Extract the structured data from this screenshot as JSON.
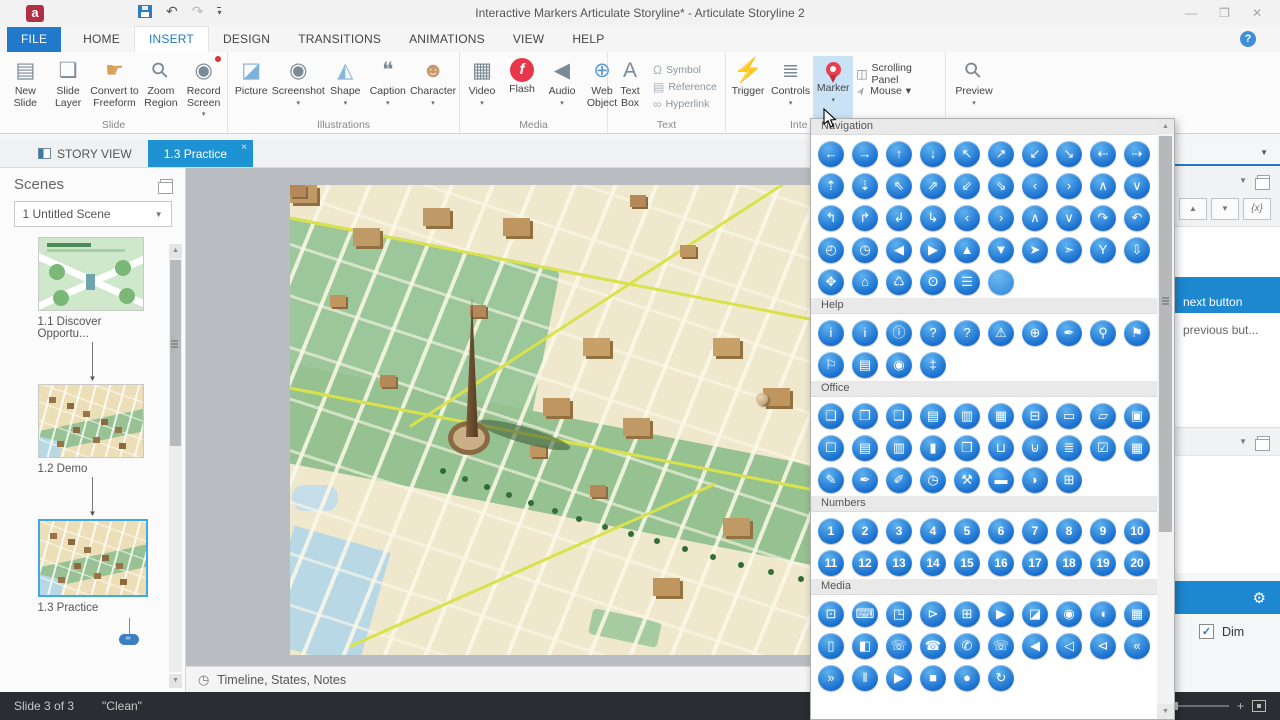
{
  "window": {
    "title": "Interactive Markers Articulate Storyline*  -  Articulate Storyline 2"
  },
  "menu_tabs": [
    "FILE",
    "HOME",
    "INSERT",
    "DESIGN",
    "TRANSITIONS",
    "ANIMATIONS",
    "VIEW",
    "HELP"
  ],
  "active_menu_tab": "INSERT",
  "ribbon": {
    "groups": [
      {
        "label": "Slide",
        "buttons": [
          {
            "label": "New Slide",
            "glyph": "▤"
          },
          {
            "label": "Slide Layer",
            "glyph": "❏"
          },
          {
            "label": "Convert to Freeform",
            "glyph": "☛"
          },
          {
            "label": "Zoom Region",
            "glyph": "⚲"
          },
          {
            "label": "Record Screen",
            "glyph": "◉",
            "dropdown": "▾"
          }
        ]
      },
      {
        "label": "Illustrations",
        "buttons": [
          {
            "label": "Picture",
            "glyph": "◪"
          },
          {
            "label": "Screenshot",
            "glyph": "◉",
            "dropdown": "▾"
          },
          {
            "label": "Shape",
            "glyph": "◭",
            "dropdown": "▾"
          },
          {
            "label": "Caption",
            "glyph": "❝",
            "dropdown": "▾"
          },
          {
            "label": "Character",
            "glyph": "☻",
            "dropdown": "▾"
          }
        ]
      },
      {
        "label": "Media",
        "buttons": [
          {
            "label": "Video",
            "glyph": "▦",
            "dropdown": "▾"
          },
          {
            "label": "Flash",
            "glyph": "f"
          },
          {
            "label": "Audio",
            "glyph": "◀",
            "dropdown": "▾"
          },
          {
            "label": "Web Object",
            "glyph": "⊕"
          }
        ]
      },
      {
        "label": "Text",
        "buttons": [
          {
            "label": "Text Box",
            "glyph": "A"
          },
          {
            "label": "Symbol",
            "glyph": "Ω"
          },
          {
            "label": "Reference",
            "glyph": "▤"
          },
          {
            "label": "Hyperlink",
            "glyph": "∞"
          }
        ]
      },
      {
        "label": "Inte",
        "buttons": [
          {
            "label": "Trigger",
            "glyph": "⚡"
          },
          {
            "label": "Controls",
            "glyph": "≣",
            "dropdown": "▾"
          },
          {
            "label": "Marker",
            "glyph": "",
            "dropdown": "▾"
          },
          {
            "label": "Scrolling Panel",
            "glyph": "◫"
          },
          {
            "label": "Mouse",
            "glyph": "➢",
            "dropdown": "▾"
          }
        ]
      },
      {
        "label": "",
        "buttons": [
          {
            "label": "Preview",
            "glyph": "⚲",
            "dropdown": "▾"
          }
        ]
      }
    ]
  },
  "view_tabs": [
    {
      "label": "STORY VIEW",
      "active": false
    },
    {
      "label": "1.3 Practice",
      "active": true,
      "close": "×"
    }
  ],
  "scenes": {
    "title": "Scenes",
    "selector": "1 Untitled Scene",
    "slides": [
      {
        "label": "1.1 Discover Opportu...",
        "style": "intro",
        "selected": false
      },
      {
        "label": "1.2 Demo",
        "style": "map",
        "selected": false
      },
      {
        "label": "1.3 Practice",
        "style": "map",
        "selected": true
      }
    ]
  },
  "canvas": {
    "footer": "Timeline, States, Notes"
  },
  "status": {
    "slide": "Slide 3 of 3",
    "state": "\"Clean\""
  },
  "right_panel": {
    "triggers": [
      {
        "label": "next button",
        "highlight": true
      },
      {
        "label": "previous but...",
        "highlight": false
      }
    ],
    "dim": "Dim"
  },
  "marker_dropdown": {
    "sections": [
      {
        "label": "Navigation",
        "rows": [
          [
            "left-arrow:←",
            "right-arrow:→",
            "up-arrow:↑",
            "down-arrow:↓",
            "up-left-arrow:↖",
            "up-right-arrow:↗",
            "down-left-arrow:↙",
            "down-right-arrow:↘",
            "left-dotted-arrow:⇠",
            "right-dotted-arrow:⇢"
          ],
          [
            "up-lined-arrow:⇡",
            "down-lined-arrow:⇣",
            "up-left-dotted-arrow:⇖",
            "up-right-dotted-arrow:⇗",
            "down-left-dotted-arrow:⇙",
            "down-right-dotted-arrow:⇘",
            "chevron-left:‹",
            "chevron-right:›",
            "chevron-up:∧",
            "chevron-down:∨"
          ],
          [
            "corner-up-left-arrow:↰",
            "corner-up-right-arrow:↱",
            "corner-down-left-arrow:↲",
            "corner-down-right-arrow:↳",
            "circle-chevron-left:‹",
            "circle-chevron-right:›",
            "circle-chevron-up:∧",
            "circle-chevron-down:∨",
            "curve-right-arrow:↷",
            "curve-up-arrow:↶"
          ],
          [
            "clock:◴",
            "clock-alt:◷",
            "triangle-left:◀",
            "triangle-right:▶",
            "triangle-up:▲",
            "triangle-down:▼",
            "cursor-arrow:➤",
            "cursor-arrow-alt:➣",
            "y-junction:Y",
            "down-arrow-small:⇩"
          ],
          [
            "expand-arrows:✥",
            "home:⌂",
            "trash:♺",
            "power:ʘ",
            "list-menu:☰",
            "blank:"
          ]
        ]
      },
      {
        "label": "Help",
        "rows": [
          [
            "info-serif:i",
            "info-italic:i",
            "info-circle:ⓘ",
            "question:?",
            "question-circle:?",
            "warning-triangle:⚠",
            "target:⊕",
            "pushpin:✒",
            "location-pin:⚲",
            "flag:⚑"
          ],
          [
            "flag-alt:⚐",
            "map:▤",
            "compass:◉",
            "signpost:‡"
          ]
        ]
      },
      {
        "label": "Office",
        "rows": [
          [
            "page:❏",
            "page-blank:❐",
            "document:❑",
            "note:▤",
            "memo:▥",
            "lined-document:▦",
            "inbox-tray:⊟",
            "folder-open:▭",
            "folder:▱",
            "file-cabinet:▣"
          ],
          [
            "archive-box:☐",
            "notebook:▤",
            "spiral-notebook:▥",
            "book:▮",
            "books:❒",
            "open-book:⊔",
            "open-book-alt:⊍",
            "library:≣",
            "clipboard-check:☑",
            "newspaper:▦"
          ],
          [
            "pencil:✎",
            "pen:✒",
            "marker-pen:✐",
            "stopwatch:◷",
            "gavel:⚒",
            "briefcase:▬",
            "tag:◗",
            "calculator:⊞"
          ]
        ]
      },
      {
        "label": "Numbers",
        "rows": [
          [
            "number-1:1",
            "number-2:2",
            "number-3:3",
            "number-4:4",
            "number-5:5",
            "number-6:6",
            "number-7:7",
            "number-8:8",
            "number-9:9",
            "number-10:10"
          ],
          [
            "number-11:11",
            "number-12:12",
            "number-13:13",
            "number-14:14",
            "number-15:15",
            "number-16:16",
            "number-17:17",
            "number-18:18",
            "number-19:19",
            "number-20:20"
          ]
        ]
      },
      {
        "label": "Media",
        "rows": [
          [
            "monitor:⊡",
            "laptop:⌨",
            "tv:◳",
            "screen-play:⊳",
            "video-frame:⊞",
            "video-play:▶",
            "image:◪",
            "camera:◉",
            "video-camera:◖",
            "film-strip:▦"
          ],
          [
            "smartphone:▯",
            "media-player:◧",
            "cell-phone:☏",
            "telephone:☎",
            "phone-call:✆",
            "phone-ring:☏",
            "speaker:◀",
            "speaker-loud:◁",
            "megaphone:⊲",
            "rewind:«"
          ],
          [
            "fast-forward:»",
            "pause:‖",
            "play:▶",
            "stop:■",
            "record:●",
            "replay:↻"
          ]
        ]
      }
    ]
  }
}
